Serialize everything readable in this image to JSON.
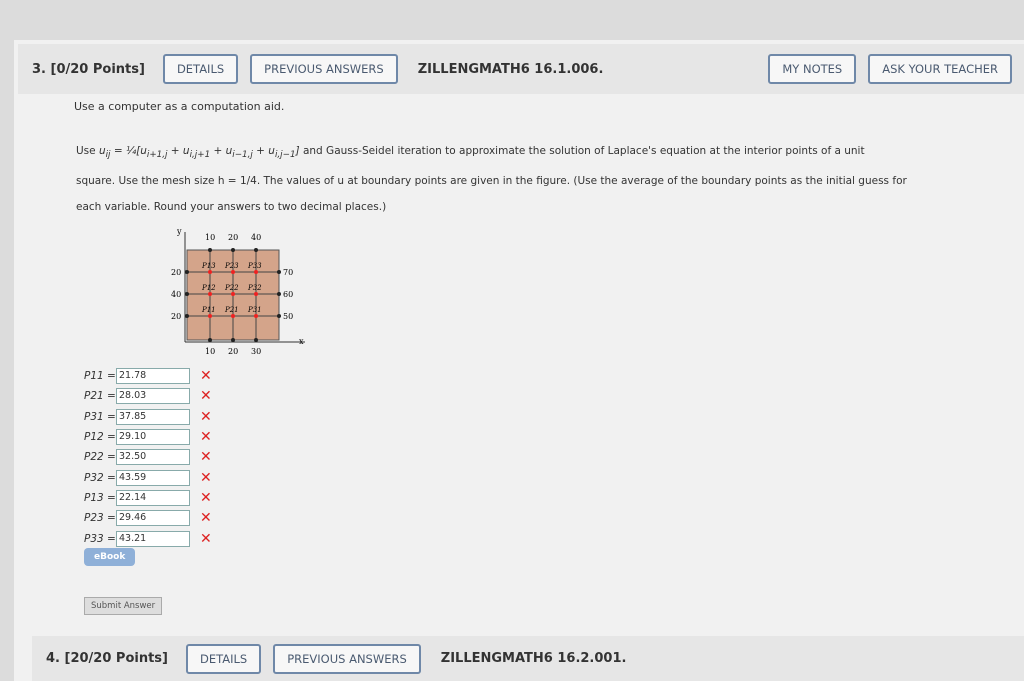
{
  "q3": {
    "number": "3.",
    "points": "[0/20 Points]",
    "details": "DETAILS",
    "previous": "PREVIOUS ANSWERS",
    "code": "ZILLENGMATH6 16.1.006.",
    "my_notes": "MY NOTES",
    "ask": "ASK YOUR TEACHER"
  },
  "intro": "Use a computer as a computation aid.",
  "problem": {
    "use": "Use",
    "formula": "u_ij = 1/4[u_{i+1,j} + u_{i,j+1} + u_{i−1,j} + u_{i,j−1}]",
    "line1_rest": "and Gauss-Seidel iteration to approximate the solution of Laplace's equation at the interior points of a unit",
    "line2": "square. Use the mesh size h = 1/4. The values of u at boundary points are given in the figure. (Use the average of the boundary points as the initial guess for",
    "line3": "each variable. Round your answers to two decimal places.)"
  },
  "figure": {
    "top": [
      "10",
      "20",
      "40"
    ],
    "bottom": [
      "10",
      "20",
      "30"
    ],
    "left": [
      "20",
      "40",
      "20"
    ],
    "right": [
      "70",
      "60",
      "50"
    ],
    "x_label": "x",
    "y_label": "y",
    "points": [
      [
        "P13",
        "P23",
        "P33"
      ],
      [
        "P12",
        "P22",
        "P32"
      ],
      [
        "P11",
        "P21",
        "P31"
      ]
    ]
  },
  "answers": [
    {
      "label": "P11 =",
      "value": "21.78",
      "status": "incorrect"
    },
    {
      "label": "P21 =",
      "value": "28.03",
      "status": "incorrect"
    },
    {
      "label": "P31 =",
      "value": "37.85",
      "status": "incorrect"
    },
    {
      "label": "P12 =",
      "value": "29.10",
      "status": "incorrect"
    },
    {
      "label": "P22 =",
      "value": "32.50",
      "status": "incorrect"
    },
    {
      "label": "P32 =",
      "value": "43.59",
      "status": "incorrect"
    },
    {
      "label": "P13 =",
      "value": "22.14",
      "status": "incorrect"
    },
    {
      "label": "P23 =",
      "value": "29.46",
      "status": "incorrect"
    },
    {
      "label": "P33 =",
      "value": "43.21",
      "status": "incorrect"
    }
  ],
  "x_mark": "✕",
  "ebook": "eBook",
  "submit": "Submit Answer",
  "q4": {
    "number": "4.",
    "points": "[20/20 Points]",
    "details": "DETAILS",
    "previous": "PREVIOUS ANSWERS",
    "code": "ZILLENGMATH6 16.2.001."
  }
}
